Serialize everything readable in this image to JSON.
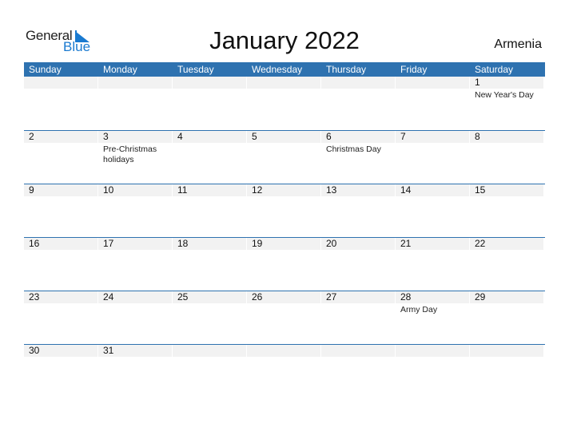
{
  "logo": {
    "general": "General",
    "blue": "Blue"
  },
  "header": {
    "title": "January 2022",
    "country": "Armenia"
  },
  "days": [
    "Sunday",
    "Monday",
    "Tuesday",
    "Wednesday",
    "Thursday",
    "Friday",
    "Saturday"
  ],
  "weeks": [
    [
      {
        "n": ""
      },
      {
        "n": ""
      },
      {
        "n": ""
      },
      {
        "n": ""
      },
      {
        "n": ""
      },
      {
        "n": ""
      },
      {
        "n": "1",
        "h": "New Year's Day"
      }
    ],
    [
      {
        "n": "2"
      },
      {
        "n": "3",
        "h": "Pre-Christmas holidays"
      },
      {
        "n": "4"
      },
      {
        "n": "5"
      },
      {
        "n": "6",
        "h": "Christmas Day"
      },
      {
        "n": "7"
      },
      {
        "n": "8"
      }
    ],
    [
      {
        "n": "9"
      },
      {
        "n": "10"
      },
      {
        "n": "11"
      },
      {
        "n": "12"
      },
      {
        "n": "13"
      },
      {
        "n": "14"
      },
      {
        "n": "15"
      }
    ],
    [
      {
        "n": "16"
      },
      {
        "n": "17"
      },
      {
        "n": "18"
      },
      {
        "n": "19"
      },
      {
        "n": "20"
      },
      {
        "n": "21"
      },
      {
        "n": "22"
      }
    ],
    [
      {
        "n": "23"
      },
      {
        "n": "24"
      },
      {
        "n": "25"
      },
      {
        "n": "26"
      },
      {
        "n": "27"
      },
      {
        "n": "28",
        "h": "Army Day"
      },
      {
        "n": "29"
      }
    ],
    [
      {
        "n": "30"
      },
      {
        "n": "31"
      },
      {
        "n": ""
      },
      {
        "n": ""
      },
      {
        "n": ""
      },
      {
        "n": ""
      },
      {
        "n": ""
      }
    ]
  ],
  "colors": {
    "accent": "#2e72b0",
    "band": "#f2f2f2",
    "logo_blue": "#1a7ad0"
  }
}
